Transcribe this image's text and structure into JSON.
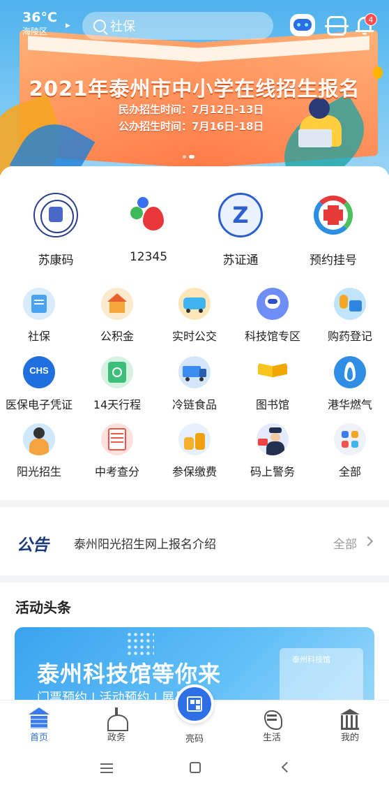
{
  "topbar": {
    "temperature": "36°C",
    "city": "海陵区",
    "search_placeholder": "社保",
    "notification_count": "4"
  },
  "banner": {
    "title": "2021年泰州市中小学在线招生报名",
    "line1": "民办招生时间：7月12日-13日",
    "line2": "公办招生时间：7月16日-18日"
  },
  "main_services": [
    {
      "label": "苏康码",
      "icon": "sukang-code-icon"
    },
    {
      "label": "12345",
      "icon": "hotline-12345-icon"
    },
    {
      "label": "苏证通",
      "icon": "suzhengtong-icon"
    },
    {
      "label": "预约挂号",
      "icon": "appointment-icon"
    }
  ],
  "services": [
    {
      "label": "社保",
      "icon": "social-security-icon",
      "color": "#4aa3f0"
    },
    {
      "label": "公积金",
      "icon": "housing-fund-icon",
      "color": "#f5a53a"
    },
    {
      "label": "实时公交",
      "icon": "bus-icon",
      "color": "#3fb4f0"
    },
    {
      "label": "科技馆专区",
      "icon": "robot-museum-icon",
      "color": "#4f7df0"
    },
    {
      "label": "购药登记",
      "icon": "medicine-icon",
      "color": "#41b6f2"
    },
    {
      "label": "医保电子凭证",
      "icon": "chs-icon",
      "color": "#1f6fe0"
    },
    {
      "label": "14天行程",
      "icon": "itinerary-icon",
      "color": "#3cbf7a"
    },
    {
      "label": "冷链食品",
      "icon": "cold-chain-icon",
      "color": "#3b8ef0"
    },
    {
      "label": "图书馆",
      "icon": "library-book-icon",
      "color": "#f7c51e"
    },
    {
      "label": "港华燃气",
      "icon": "gas-flame-icon",
      "color": "#2f8de4"
    },
    {
      "label": "阳光招生",
      "icon": "student-icon",
      "color": "#57b0f3"
    },
    {
      "label": "中考查分",
      "icon": "exam-score-icon",
      "color": "#e8574a"
    },
    {
      "label": "参保缴费",
      "icon": "coins-icon",
      "color": "#f5b12e"
    },
    {
      "label": "码上警务",
      "icon": "police-icon",
      "color": "#3a6ee8"
    },
    {
      "label": "全部",
      "icon": "all-apps-icon",
      "color": "#e9eef7"
    }
  ],
  "notice": {
    "tag": "公告",
    "text": "泰州阳光招生网上报名介绍",
    "more": "全部"
  },
  "activity": {
    "title": "活动头条",
    "banner_heading": "泰州科技馆等你来",
    "banner_sub": "门票预约 | 活动预约 | 展品预约",
    "building_label": "泰州科技馆"
  },
  "tabbar": {
    "home": "首页",
    "gov": "政务",
    "scan": "亮码",
    "life": "生活",
    "me": "我的"
  }
}
